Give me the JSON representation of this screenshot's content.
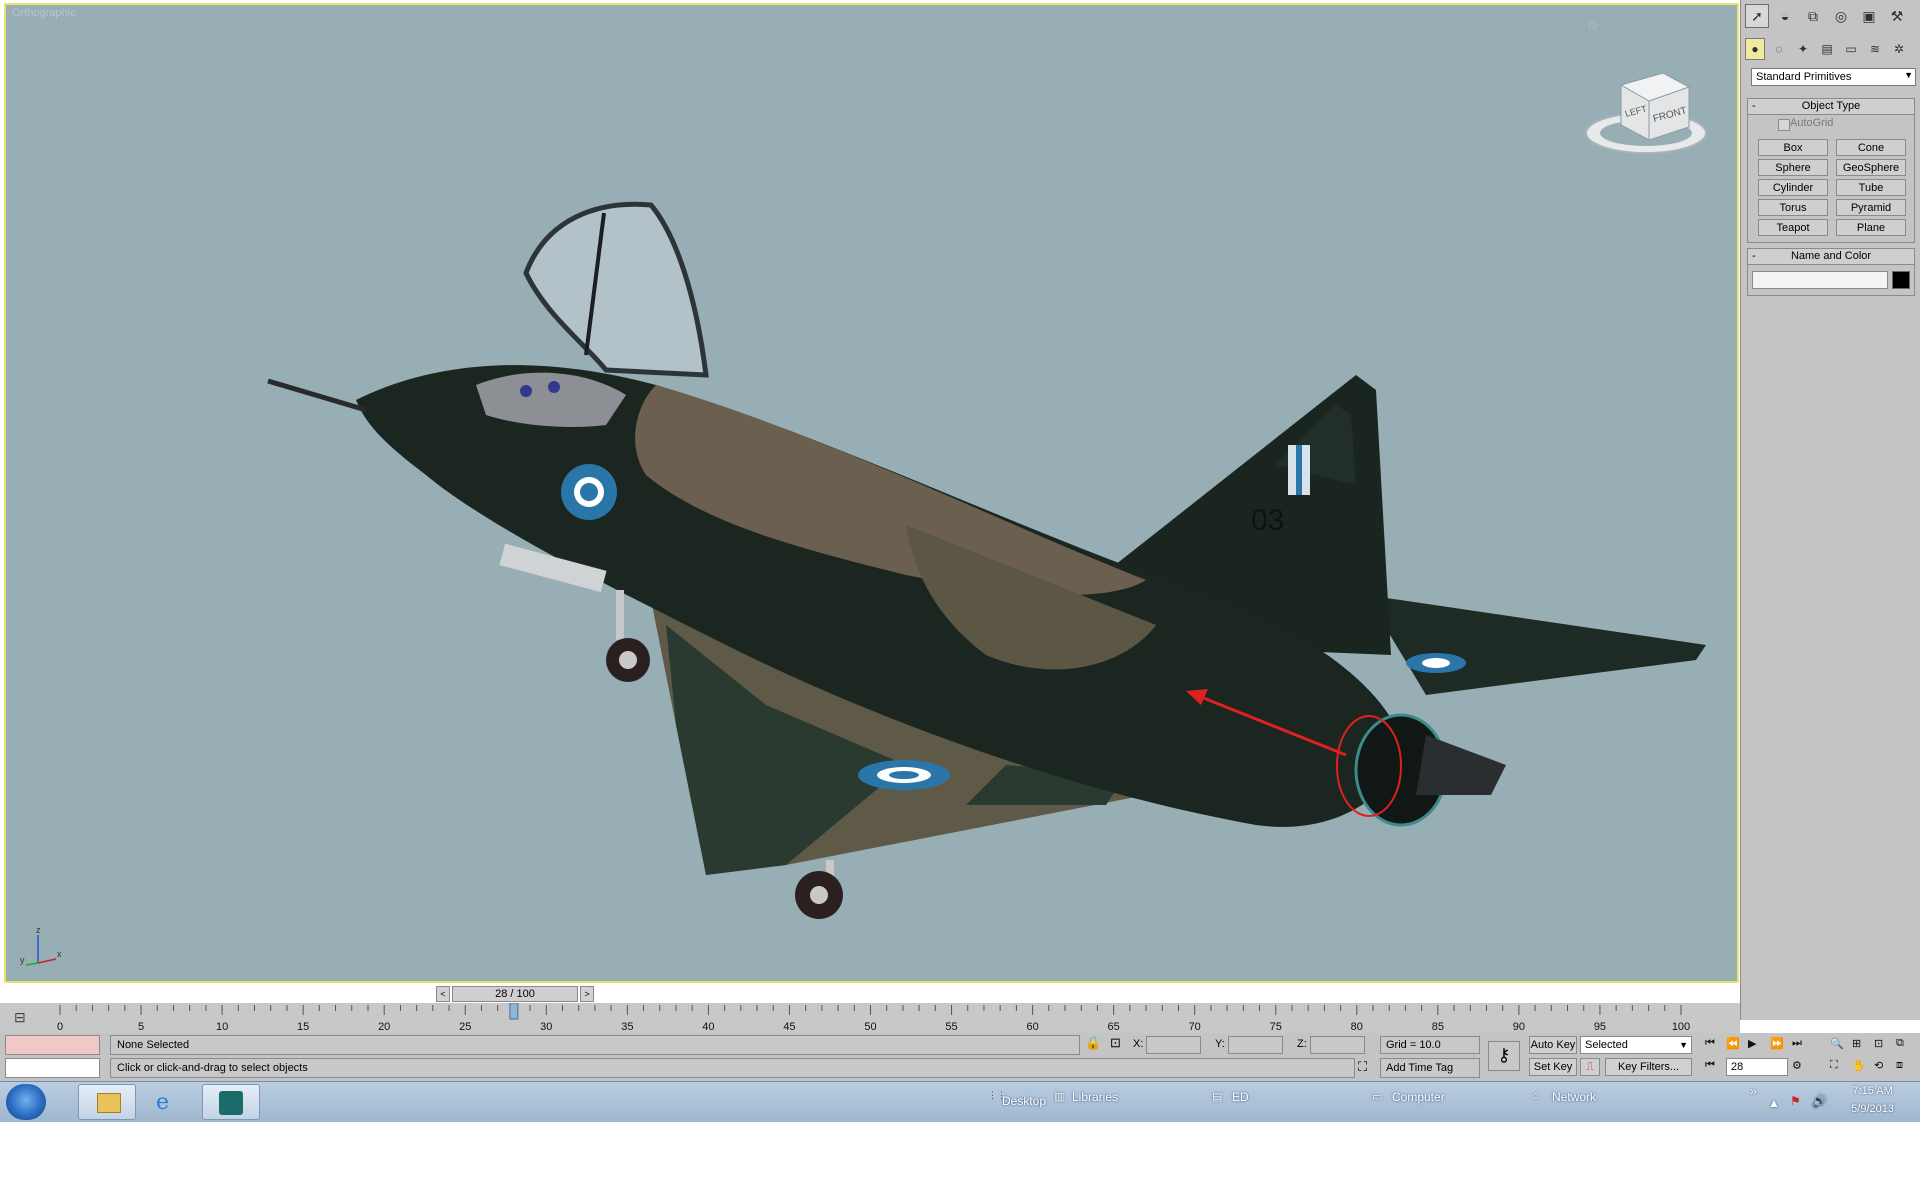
{
  "viewport": {
    "label": "Orthographic",
    "viewcube_left": "LEFT",
    "viewcube_front": "FRONT",
    "axis_x": "x",
    "axis_y": "y",
    "axis_z": "z",
    "model": {
      "tail_number": "03",
      "markings": "Greek roundels"
    }
  },
  "command_panel": {
    "dropdown": "Standard Primitives",
    "object_type": {
      "title": "Object Type",
      "autogrid": "AutoGrid",
      "buttons": [
        "Box",
        "Cone",
        "Sphere",
        "GeoSphere",
        "Cylinder",
        "Tube",
        "Torus",
        "Pyramid",
        "Teapot",
        "Plane"
      ]
    },
    "name_and_color": {
      "title": "Name and Color"
    }
  },
  "time_slider": {
    "label": "28 / 100",
    "current": 28,
    "total": 100
  },
  "track_bar": {
    "ticks": [
      "0",
      "5",
      "10",
      "15",
      "20",
      "25",
      "30",
      "35",
      "40",
      "45",
      "50",
      "55",
      "60",
      "65",
      "70",
      "75",
      "80",
      "85",
      "90",
      "95",
      "100"
    ]
  },
  "status": {
    "selection": "None Selected",
    "prompt": "Click or click-and-drag to select objects",
    "x_label": "X:",
    "y_label": "Y:",
    "z_label": "Z:",
    "grid": "Grid = 10.0",
    "add_time_tag": "Add Time Tag"
  },
  "anim": {
    "auto_key": "Auto Key",
    "set_key": "Set Key",
    "selected": "Selected",
    "key_filters": "Key Filters...",
    "frame": "28"
  },
  "taskbar": {
    "desktop": "Desktop",
    "libraries": "Libraries",
    "ed": "ED",
    "computer": "Computer",
    "network": "Network",
    "time": "7:15 AM",
    "date": "5/9/2013"
  }
}
